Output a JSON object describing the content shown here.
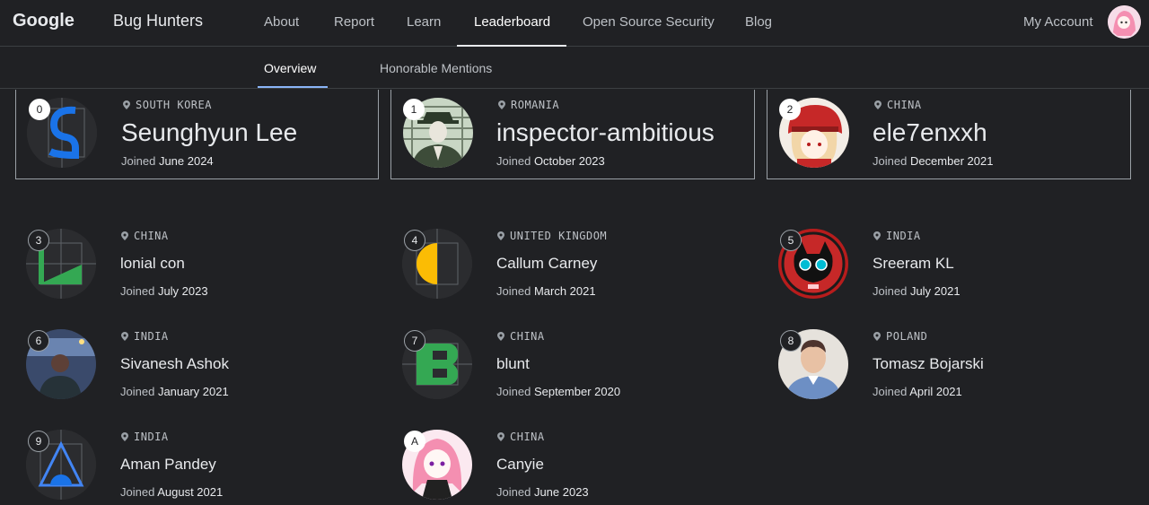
{
  "header": {
    "logo": "Google",
    "site_name": "Bug Hunters",
    "nav": [
      "About",
      "Report",
      "Learn",
      "Leaderboard",
      "Open Source Security",
      "Blog"
    ],
    "account": "My Account"
  },
  "subnav": [
    "Overview",
    "Honorable Mentions"
  ],
  "joined_label": "Joined",
  "top3": [
    {
      "rank": "0",
      "country": "SOUTH KOREA",
      "name": "Seunghyun Lee",
      "joined": "June 2024"
    },
    {
      "rank": "1",
      "country": "ROMANIA",
      "name": "inspector-ambitious",
      "joined": "October 2023"
    },
    {
      "rank": "2",
      "country": "CHINA",
      "name": "ele7enxxh",
      "joined": "December 2021"
    }
  ],
  "others": [
    {
      "rank": "3",
      "country": "CHINA",
      "name": "lonial con",
      "joined": "July 2023"
    },
    {
      "rank": "4",
      "country": "UNITED KINGDOM",
      "name": "Callum Carney",
      "joined": "March 2021"
    },
    {
      "rank": "5",
      "country": "INDIA",
      "name": "Sreeram KL",
      "joined": "July 2021"
    },
    {
      "rank": "6",
      "country": "INDIA",
      "name": "Sivanesh Ashok",
      "joined": "January 2021"
    },
    {
      "rank": "7",
      "country": "CHINA",
      "name": "blunt",
      "joined": "September 2020"
    },
    {
      "rank": "8",
      "country": "POLAND",
      "name": "Tomasz Bojarski",
      "joined": "April 2021"
    },
    {
      "rank": "9",
      "country": "INDIA",
      "name": "Aman Pandey",
      "joined": "August 2021"
    },
    {
      "rank": "A",
      "country": "CHINA",
      "name": "Canyie",
      "joined": "June 2023"
    }
  ],
  "colors": {
    "background": "#202124",
    "accent": "#8ab4f8",
    "green": "#34a853",
    "yellow": "#fbbc04",
    "blue": "#4285f4"
  }
}
